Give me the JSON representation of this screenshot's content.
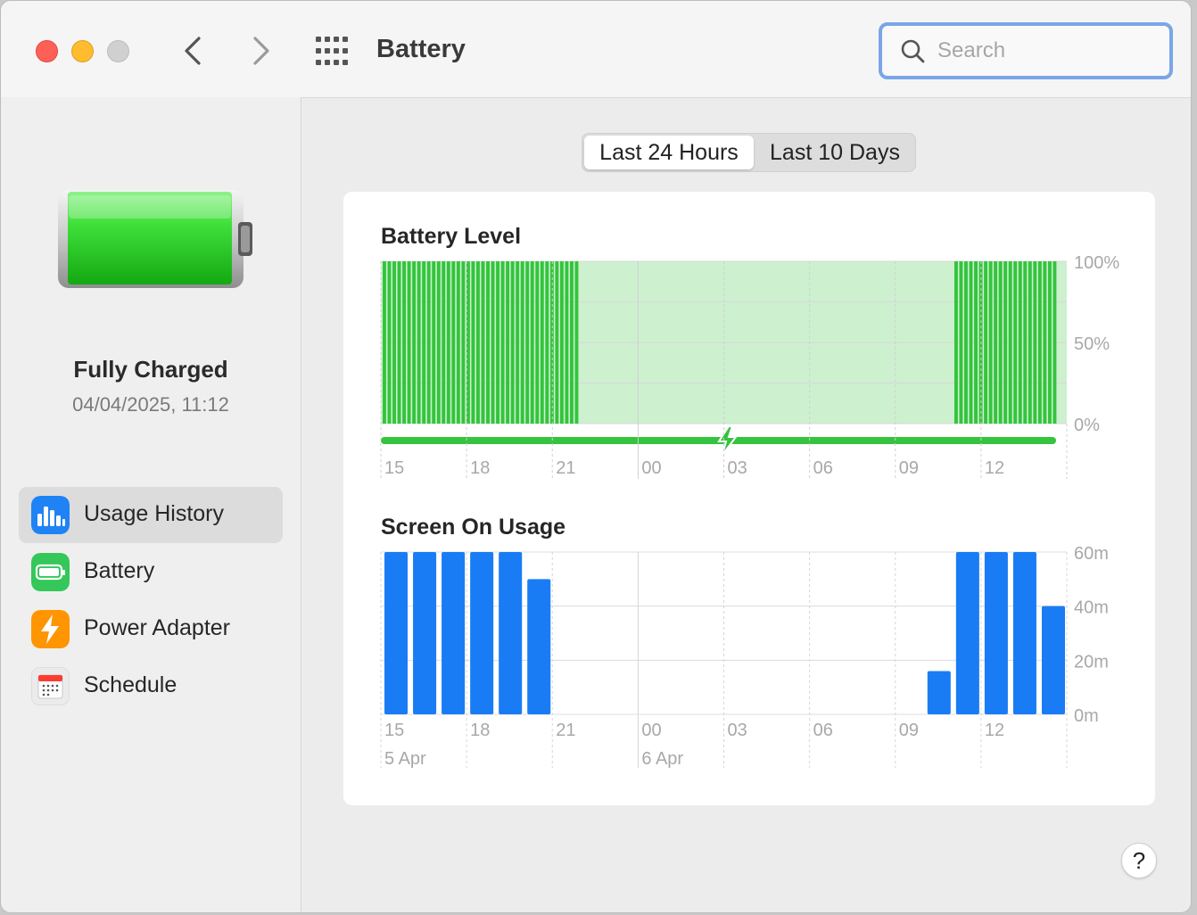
{
  "window": {
    "title": "Battery"
  },
  "search": {
    "placeholder": "Search",
    "value": ""
  },
  "sidebar": {
    "status_title": "Fully Charged",
    "status_date": "04/04/2025, 11:12",
    "items": [
      {
        "label": "Usage History",
        "icon": "bar-chart-icon",
        "color": "#1f83f6",
        "selected": true
      },
      {
        "label": "Battery",
        "icon": "battery-icon",
        "color": "#34c759",
        "selected": false
      },
      {
        "label": "Power Adapter",
        "icon": "lightning-icon",
        "color": "#ff9500",
        "selected": false
      },
      {
        "label": "Schedule",
        "icon": "calendar-icon",
        "color": "#e6e6e6",
        "selected": false
      }
    ]
  },
  "segmented": {
    "options": [
      "Last 24 Hours",
      "Last 10 Days"
    ],
    "selected": "Last 24 Hours"
  },
  "colors": {
    "battery_green": "#34c43d",
    "charging_band": "#cdf0cf",
    "usage_blue": "#1a7cf5"
  },
  "chart_data": [
    {
      "type": "bar",
      "title": "Battery Level",
      "x_tick_labels": [
        "15",
        "18",
        "21",
        "00",
        "03",
        "06",
        "09",
        "12"
      ],
      "y_tick_labels": [
        "100%",
        "50%",
        "0%"
      ],
      "ylim": [
        0,
        100
      ],
      "series": [
        {
          "values": [
            100,
            100,
            100,
            100,
            100,
            100,
            100,
            100,
            100,
            100,
            100,
            100,
            100,
            100,
            100,
            100,
            100,
            100,
            100,
            100,
            100,
            100,
            100,
            100,
            100,
            100,
            100,
            100,
            100,
            100,
            100,
            100,
            100,
            100,
            100,
            100,
            100,
            100,
            100,
            100,
            null,
            null,
            null,
            null,
            null,
            null,
            null,
            null,
            null,
            null,
            null,
            null,
            null,
            null,
            null,
            null,
            null,
            null,
            null,
            null,
            null,
            null,
            null,
            null,
            null,
            null,
            null,
            null,
            null,
            null,
            null,
            null,
            null,
            null,
            null,
            null,
            null,
            null,
            null,
            null,
            null,
            null,
            null,
            null,
            null,
            null,
            null,
            null,
            null,
            null,
            null,
            null,
            null,
            null,
            null,
            null,
            null,
            null,
            null,
            null,
            null,
            null,
            null,
            null,
            null,
            null,
            null,
            null,
            null,
            null,
            null,
            null,
            null,
            null,
            null,
            null,
            100,
            100,
            100,
            100,
            100,
            100,
            100,
            100,
            100,
            100,
            100,
            100,
            100,
            100,
            100,
            100,
            100,
            100,
            100,
            100,
            100
          ]
        }
      ],
      "charging_shaded": true,
      "charging_bar": true,
      "grid": true
    },
    {
      "type": "bar",
      "title": "Screen On Usage",
      "x_tick_labels": [
        "15",
        "18",
        "21",
        "00",
        "03",
        "06",
        "09",
        "12"
      ],
      "date_labels": [
        "5 Apr",
        "6 Apr"
      ],
      "y_tick_labels": [
        "60m",
        "40m",
        "20m",
        "0m"
      ],
      "ylim": [
        0,
        60
      ],
      "unit": "m",
      "series": [
        {
          "values": [
            60,
            60,
            60,
            60,
            60,
            50,
            0,
            0,
            0,
            0,
            0,
            0,
            0,
            0,
            0,
            0,
            0,
            0,
            0,
            16,
            60,
            60,
            60,
            40
          ]
        }
      ],
      "grid": true
    }
  ]
}
